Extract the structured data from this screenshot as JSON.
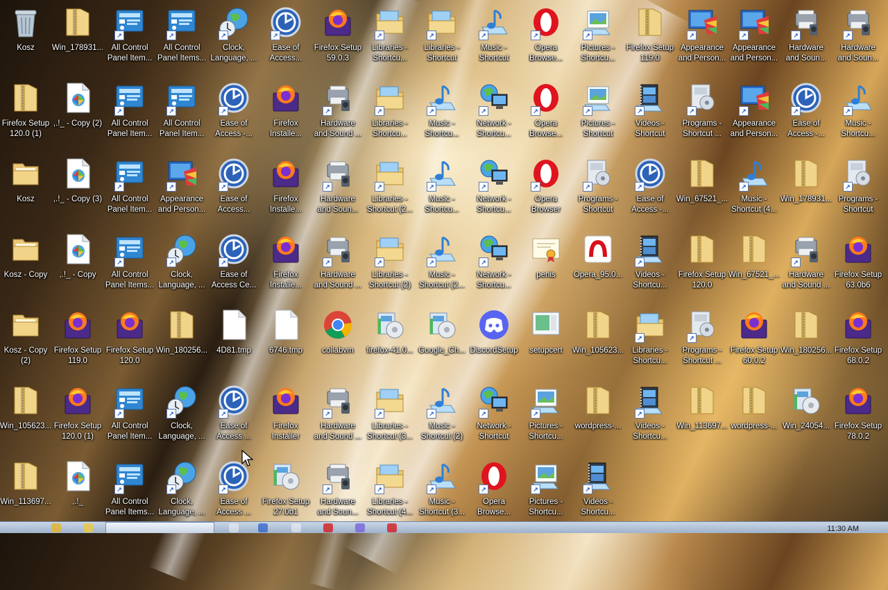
{
  "desktop": {
    "icons": [
      {
        "label": "Kosz",
        "type": "recycle"
      },
      {
        "label": "Win_178931...",
        "type": "zip"
      },
      {
        "label": "All Control\nPanel Item...",
        "type": "cpl",
        "shortcut": true
      },
      {
        "label": "All Control\nPanel Items...",
        "type": "cpl",
        "shortcut": true
      },
      {
        "label": "Clock,\nLanguage, ...",
        "type": "globe",
        "shortcut": true
      },
      {
        "label": "Ease of\nAccess...",
        "type": "ease",
        "shortcut": true
      },
      {
        "label": "Firefox Setup\n59.0.3",
        "type": "firefox"
      },
      {
        "label": "Libraries -\nShortcu...",
        "type": "library",
        "shortcut": true
      },
      {
        "label": "Libraries -\nShortcut",
        "type": "library",
        "shortcut": true
      },
      {
        "label": "Music -\nShortcut",
        "type": "music",
        "shortcut": true
      },
      {
        "label": "Opera\nBrowse...",
        "type": "opera",
        "shortcut": true
      },
      {
        "label": "Pictures -\nShortcu...",
        "type": "pictures",
        "shortcut": true
      },
      {
        "label": "Firefox Setup\n119.0",
        "type": "zip"
      },
      {
        "label": "Appearance\nand Person...",
        "type": "appearance",
        "shortcut": true
      },
      {
        "label": "Appearance\nand Person...",
        "type": "appearance",
        "shortcut": true
      },
      {
        "label": "Hardware\nand Soun...",
        "type": "hardware",
        "shortcut": true
      },
      {
        "label": "Hardware\nand Soun...",
        "type": "hardware",
        "shortcut": true
      },
      {
        "label": "Firefox Setup\n120.0 (1)",
        "type": "zip"
      },
      {
        "label": ",.!_ - Copy (2)",
        "type": "winfile"
      },
      {
        "label": "All Control\nPanel Item...",
        "type": "cpl",
        "shortcut": true
      },
      {
        "label": "All Control\nPanel Item...",
        "type": "cpl",
        "shortcut": true
      },
      {
        "label": "Ease of\nAccess -...",
        "type": "ease",
        "shortcut": true
      },
      {
        "label": "Firefox\nInstalle...",
        "type": "firefox"
      },
      {
        "label": "Hardware\nand Sound ...",
        "type": "hardware",
        "shortcut": true
      },
      {
        "label": "Libraries -\nShortcu...",
        "type": "library",
        "shortcut": true
      },
      {
        "label": "Music -\nShortcu...",
        "type": "music",
        "shortcut": true
      },
      {
        "label": "Network -\nShortcu...",
        "type": "network",
        "shortcut": true
      },
      {
        "label": "Opera\nBrowse...",
        "type": "opera",
        "shortcut": true
      },
      {
        "label": "Pictures -\nShortcut",
        "type": "pictures",
        "shortcut": true
      },
      {
        "label": "Videos -\nShortcut",
        "type": "videos",
        "shortcut": true
      },
      {
        "label": "Programs -\nShortcut ...",
        "type": "programs",
        "shortcut": true
      },
      {
        "label": "Appearance\nand Person...",
        "type": "appearance",
        "shortcut": true
      },
      {
        "label": "Ease of\nAccess -...",
        "type": "ease",
        "shortcut": true
      },
      {
        "label": "Music -\nShortcu...",
        "type": "music",
        "shortcut": true
      },
      {
        "label": "Kosz",
        "type": "folder"
      },
      {
        "label": ",.!_ - Copy (3)",
        "type": "winfile"
      },
      {
        "label": "All Control\nPanel Item...",
        "type": "cpl",
        "shortcut": true
      },
      {
        "label": "Appearance\nand Person...",
        "type": "appearance",
        "shortcut": true
      },
      {
        "label": "Ease of\nAccess...",
        "type": "ease",
        "shortcut": true
      },
      {
        "label": "Firefox\nInstalle...",
        "type": "firefox"
      },
      {
        "label": "Hardware\nand Soun...",
        "type": "hardware",
        "shortcut": true
      },
      {
        "label": "Libraries -\nShortcut (2...",
        "type": "library",
        "shortcut": true
      },
      {
        "label": "Music -\nShortcu...",
        "type": "music",
        "shortcut": true
      },
      {
        "label": "Network -\nShortcu...",
        "type": "network",
        "shortcut": true
      },
      {
        "label": "Opera\nBrowser",
        "type": "opera",
        "shortcut": true
      },
      {
        "label": "Programs -\nShortcut",
        "type": "programs",
        "shortcut": true
      },
      {
        "label": "Ease of\nAccess -...",
        "type": "ease",
        "shortcut": true
      },
      {
        "label": "Win_67521_...",
        "type": "zip"
      },
      {
        "label": "Music -\nShortcut (4...",
        "type": "music",
        "shortcut": true
      },
      {
        "label": "Win_178931...",
        "type": "zip"
      },
      {
        "label": "Programs -\nShortcut",
        "type": "programs",
        "shortcut": true
      },
      {
        "label": "Kosz - Copy",
        "type": "folder"
      },
      {
        "label": ",.!_ - Copy",
        "type": "winfile"
      },
      {
        "label": "All Control\nPanel Items...",
        "type": "cpl",
        "shortcut": true
      },
      {
        "label": "Clock,\nLanguage, ...",
        "type": "globe",
        "shortcut": true
      },
      {
        "label": "Ease of\nAccess Ce...",
        "type": "ease",
        "shortcut": true
      },
      {
        "label": "Firefox\nInstalle...",
        "type": "firefox"
      },
      {
        "label": "Hardware\nand Sound ...",
        "type": "hardware",
        "shortcut": true
      },
      {
        "label": "Libraries -\nShortcut (2)",
        "type": "library",
        "shortcut": true
      },
      {
        "label": "Music -\nShortcut (2...",
        "type": "music",
        "shortcut": true
      },
      {
        "label": "Network -\nShortcu...",
        "type": "network",
        "shortcut": true
      },
      {
        "label": "penis",
        "type": "cert"
      },
      {
        "label": "Opera_95.0...",
        "type": "opera-setup"
      },
      {
        "label": "Videos -\nShortcu...",
        "type": "videos",
        "shortcut": true
      },
      {
        "label": "Firefox Setup\n120.0",
        "type": "zip"
      },
      {
        "label": "Win_67521_...",
        "type": "zip"
      },
      {
        "label": "Hardware\nand Sound ...",
        "type": "hardware",
        "shortcut": true
      },
      {
        "label": "Firefox Setup\n63.0b6",
        "type": "firefox"
      },
      {
        "label": "Kosz - Copy\n(2)",
        "type": "folder"
      },
      {
        "label": "Firefox Setup\n119.0",
        "type": "firefox"
      },
      {
        "label": "Firefox Setup\n120.0",
        "type": "firefox"
      },
      {
        "label": "Win_180256...",
        "type": "zip"
      },
      {
        "label": "4D81.tmp",
        "type": "blank"
      },
      {
        "label": "6746.tmp",
        "type": "blank"
      },
      {
        "label": "collabvm",
        "type": "chrome"
      },
      {
        "label": "firefox-41.0...",
        "type": "installer"
      },
      {
        "label": "Google_Ch...",
        "type": "installer"
      },
      {
        "label": "DiscordSetup",
        "type": "discord"
      },
      {
        "label": "setupcert",
        "type": "setupcert"
      },
      {
        "label": "Win_105623...",
        "type": "zip"
      },
      {
        "label": "Libraries -\nShortcu...",
        "type": "library",
        "shortcut": true
      },
      {
        "label": "Programs -\nShortcut ...",
        "type": "programs",
        "shortcut": true
      },
      {
        "label": "Firefox Setup\n60.0.2",
        "type": "firefox"
      },
      {
        "label": "Win_180256...",
        "type": "zip"
      },
      {
        "label": "Firefox Setup\n68.0.2",
        "type": "firefox"
      },
      {
        "label": "Win_105623...",
        "type": "zip"
      },
      {
        "label": "Firefox Setup\n120.0 (1)",
        "type": "firefox"
      },
      {
        "label": "All Control\nPanel Item...",
        "type": "cpl",
        "shortcut": true
      },
      {
        "label": "Clock,\nLanguage, ...",
        "type": "globe",
        "shortcut": true
      },
      {
        "label": "Ease of\nAccess ...",
        "type": "ease",
        "shortcut": true
      },
      {
        "label": "Firefox\nInstaller",
        "type": "firefox"
      },
      {
        "label": "Hardware\nand Sound ...",
        "type": "hardware",
        "shortcut": true
      },
      {
        "label": "Libraries -\nShortcut (3...",
        "type": "library",
        "shortcut": true
      },
      {
        "label": "Music -\nShortcut (2)",
        "type": "music",
        "shortcut": true
      },
      {
        "label": "Network -\nShortcut",
        "type": "network",
        "shortcut": true
      },
      {
        "label": "Pictures -\nShortcu...",
        "type": "pictures",
        "shortcut": true
      },
      {
        "label": "wordpress-...",
        "type": "zip"
      },
      {
        "label": "Videos -\nShortcu...",
        "type": "videos",
        "shortcut": true
      },
      {
        "label": "Win_113697...",
        "type": "zip"
      },
      {
        "label": "wordpress-...",
        "type": "zip"
      },
      {
        "label": "Win_24054...",
        "type": "installer"
      },
      {
        "label": "Firefox Setup\n78.0.2",
        "type": "firefox"
      },
      {
        "label": "Win_113697...",
        "type": "zip"
      },
      {
        "label": ",.!_",
        "type": "winfile"
      },
      {
        "label": "All Control\nPanel Items...",
        "type": "cpl",
        "shortcut": true
      },
      {
        "label": "Clock,\nLanguage, ...",
        "type": "globe",
        "shortcut": true
      },
      {
        "label": "Ease of\nAccess ...",
        "type": "ease",
        "shortcut": true
      },
      {
        "label": "Firefox Setup\n27.0b1",
        "type": "installer"
      },
      {
        "label": "Hardware\nand Soun...",
        "type": "hardware",
        "shortcut": true
      },
      {
        "label": "Libraries -\nShortcut (4...",
        "type": "library",
        "shortcut": true
      },
      {
        "label": "Music -\nShortcut (3...",
        "type": "music",
        "shortcut": true
      },
      {
        "label": "Opera\nBrowse...",
        "type": "opera",
        "shortcut": true
      },
      {
        "label": "Pictures -\nShortcu...",
        "type": "pictures",
        "shortcut": true
      },
      {
        "label": "Videos -\nShortcu...",
        "type": "videos",
        "shortcut": true
      }
    ]
  },
  "taskbar": {
    "clock": "11:30 AM"
  },
  "colors": {
    "label_text": "#ffffff",
    "taskbar": "#b4c4d9"
  }
}
